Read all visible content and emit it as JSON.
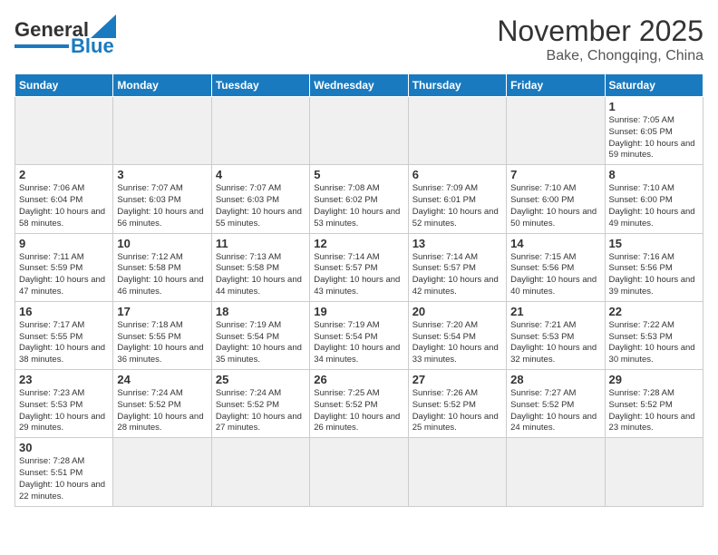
{
  "header": {
    "logo_general": "General",
    "logo_blue": "Blue",
    "month_title": "November 2025",
    "location": "Bake, Chongqing, China"
  },
  "weekdays": [
    "Sunday",
    "Monday",
    "Tuesday",
    "Wednesday",
    "Thursday",
    "Friday",
    "Saturday"
  ],
  "days": [
    {
      "date": "",
      "empty": true
    },
    {
      "date": "",
      "empty": true
    },
    {
      "date": "",
      "empty": true
    },
    {
      "date": "",
      "empty": true
    },
    {
      "date": "",
      "empty": true
    },
    {
      "date": "",
      "empty": true
    },
    {
      "date": "1",
      "sunrise": "Sunrise: 7:05 AM",
      "sunset": "Sunset: 6:05 PM",
      "daylight": "Daylight: 10 hours and 59 minutes."
    },
    {
      "date": "2",
      "sunrise": "Sunrise: 7:06 AM",
      "sunset": "Sunset: 6:04 PM",
      "daylight": "Daylight: 10 hours and 58 minutes."
    },
    {
      "date": "3",
      "sunrise": "Sunrise: 7:07 AM",
      "sunset": "Sunset: 6:03 PM",
      "daylight": "Daylight: 10 hours and 56 minutes."
    },
    {
      "date": "4",
      "sunrise": "Sunrise: 7:07 AM",
      "sunset": "Sunset: 6:03 PM",
      "daylight": "Daylight: 10 hours and 55 minutes."
    },
    {
      "date": "5",
      "sunrise": "Sunrise: 7:08 AM",
      "sunset": "Sunset: 6:02 PM",
      "daylight": "Daylight: 10 hours and 53 minutes."
    },
    {
      "date": "6",
      "sunrise": "Sunrise: 7:09 AM",
      "sunset": "Sunset: 6:01 PM",
      "daylight": "Daylight: 10 hours and 52 minutes."
    },
    {
      "date": "7",
      "sunrise": "Sunrise: 7:10 AM",
      "sunset": "Sunset: 6:00 PM",
      "daylight": "Daylight: 10 hours and 50 minutes."
    },
    {
      "date": "8",
      "sunrise": "Sunrise: 7:10 AM",
      "sunset": "Sunset: 6:00 PM",
      "daylight": "Daylight: 10 hours and 49 minutes."
    },
    {
      "date": "9",
      "sunrise": "Sunrise: 7:11 AM",
      "sunset": "Sunset: 5:59 PM",
      "daylight": "Daylight: 10 hours and 47 minutes."
    },
    {
      "date": "10",
      "sunrise": "Sunrise: 7:12 AM",
      "sunset": "Sunset: 5:58 PM",
      "daylight": "Daylight: 10 hours and 46 minutes."
    },
    {
      "date": "11",
      "sunrise": "Sunrise: 7:13 AM",
      "sunset": "Sunset: 5:58 PM",
      "daylight": "Daylight: 10 hours and 44 minutes."
    },
    {
      "date": "12",
      "sunrise": "Sunrise: 7:14 AM",
      "sunset": "Sunset: 5:57 PM",
      "daylight": "Daylight: 10 hours and 43 minutes."
    },
    {
      "date": "13",
      "sunrise": "Sunrise: 7:14 AM",
      "sunset": "Sunset: 5:57 PM",
      "daylight": "Daylight: 10 hours and 42 minutes."
    },
    {
      "date": "14",
      "sunrise": "Sunrise: 7:15 AM",
      "sunset": "Sunset: 5:56 PM",
      "daylight": "Daylight: 10 hours and 40 minutes."
    },
    {
      "date": "15",
      "sunrise": "Sunrise: 7:16 AM",
      "sunset": "Sunset: 5:56 PM",
      "daylight": "Daylight: 10 hours and 39 minutes."
    },
    {
      "date": "16",
      "sunrise": "Sunrise: 7:17 AM",
      "sunset": "Sunset: 5:55 PM",
      "daylight": "Daylight: 10 hours and 38 minutes."
    },
    {
      "date": "17",
      "sunrise": "Sunrise: 7:18 AM",
      "sunset": "Sunset: 5:55 PM",
      "daylight": "Daylight: 10 hours and 36 minutes."
    },
    {
      "date": "18",
      "sunrise": "Sunrise: 7:19 AM",
      "sunset": "Sunset: 5:54 PM",
      "daylight": "Daylight: 10 hours and 35 minutes."
    },
    {
      "date": "19",
      "sunrise": "Sunrise: 7:19 AM",
      "sunset": "Sunset: 5:54 PM",
      "daylight": "Daylight: 10 hours and 34 minutes."
    },
    {
      "date": "20",
      "sunrise": "Sunrise: 7:20 AM",
      "sunset": "Sunset: 5:54 PM",
      "daylight": "Daylight: 10 hours and 33 minutes."
    },
    {
      "date": "21",
      "sunrise": "Sunrise: 7:21 AM",
      "sunset": "Sunset: 5:53 PM",
      "daylight": "Daylight: 10 hours and 32 minutes."
    },
    {
      "date": "22",
      "sunrise": "Sunrise: 7:22 AM",
      "sunset": "Sunset: 5:53 PM",
      "daylight": "Daylight: 10 hours and 30 minutes."
    },
    {
      "date": "23",
      "sunrise": "Sunrise: 7:23 AM",
      "sunset": "Sunset: 5:53 PM",
      "daylight": "Daylight: 10 hours and 29 minutes."
    },
    {
      "date": "24",
      "sunrise": "Sunrise: 7:24 AM",
      "sunset": "Sunset: 5:52 PM",
      "daylight": "Daylight: 10 hours and 28 minutes."
    },
    {
      "date": "25",
      "sunrise": "Sunrise: 7:24 AM",
      "sunset": "Sunset: 5:52 PM",
      "daylight": "Daylight: 10 hours and 27 minutes."
    },
    {
      "date": "26",
      "sunrise": "Sunrise: 7:25 AM",
      "sunset": "Sunset: 5:52 PM",
      "daylight": "Daylight: 10 hours and 26 minutes."
    },
    {
      "date": "27",
      "sunrise": "Sunrise: 7:26 AM",
      "sunset": "Sunset: 5:52 PM",
      "daylight": "Daylight: 10 hours and 25 minutes."
    },
    {
      "date": "28",
      "sunrise": "Sunrise: 7:27 AM",
      "sunset": "Sunset: 5:52 PM",
      "daylight": "Daylight: 10 hours and 24 minutes."
    },
    {
      "date": "29",
      "sunrise": "Sunrise: 7:28 AM",
      "sunset": "Sunset: 5:52 PM",
      "daylight": "Daylight: 10 hours and 23 minutes."
    },
    {
      "date": "30",
      "sunrise": "Sunrise: 7:28 AM",
      "sunset": "Sunset: 5:51 PM",
      "daylight": "Daylight: 10 hours and 22 minutes."
    },
    {
      "date": "",
      "empty": true
    },
    {
      "date": "",
      "empty": true
    },
    {
      "date": "",
      "empty": true
    },
    {
      "date": "",
      "empty": true
    },
    {
      "date": "",
      "empty": true
    }
  ]
}
